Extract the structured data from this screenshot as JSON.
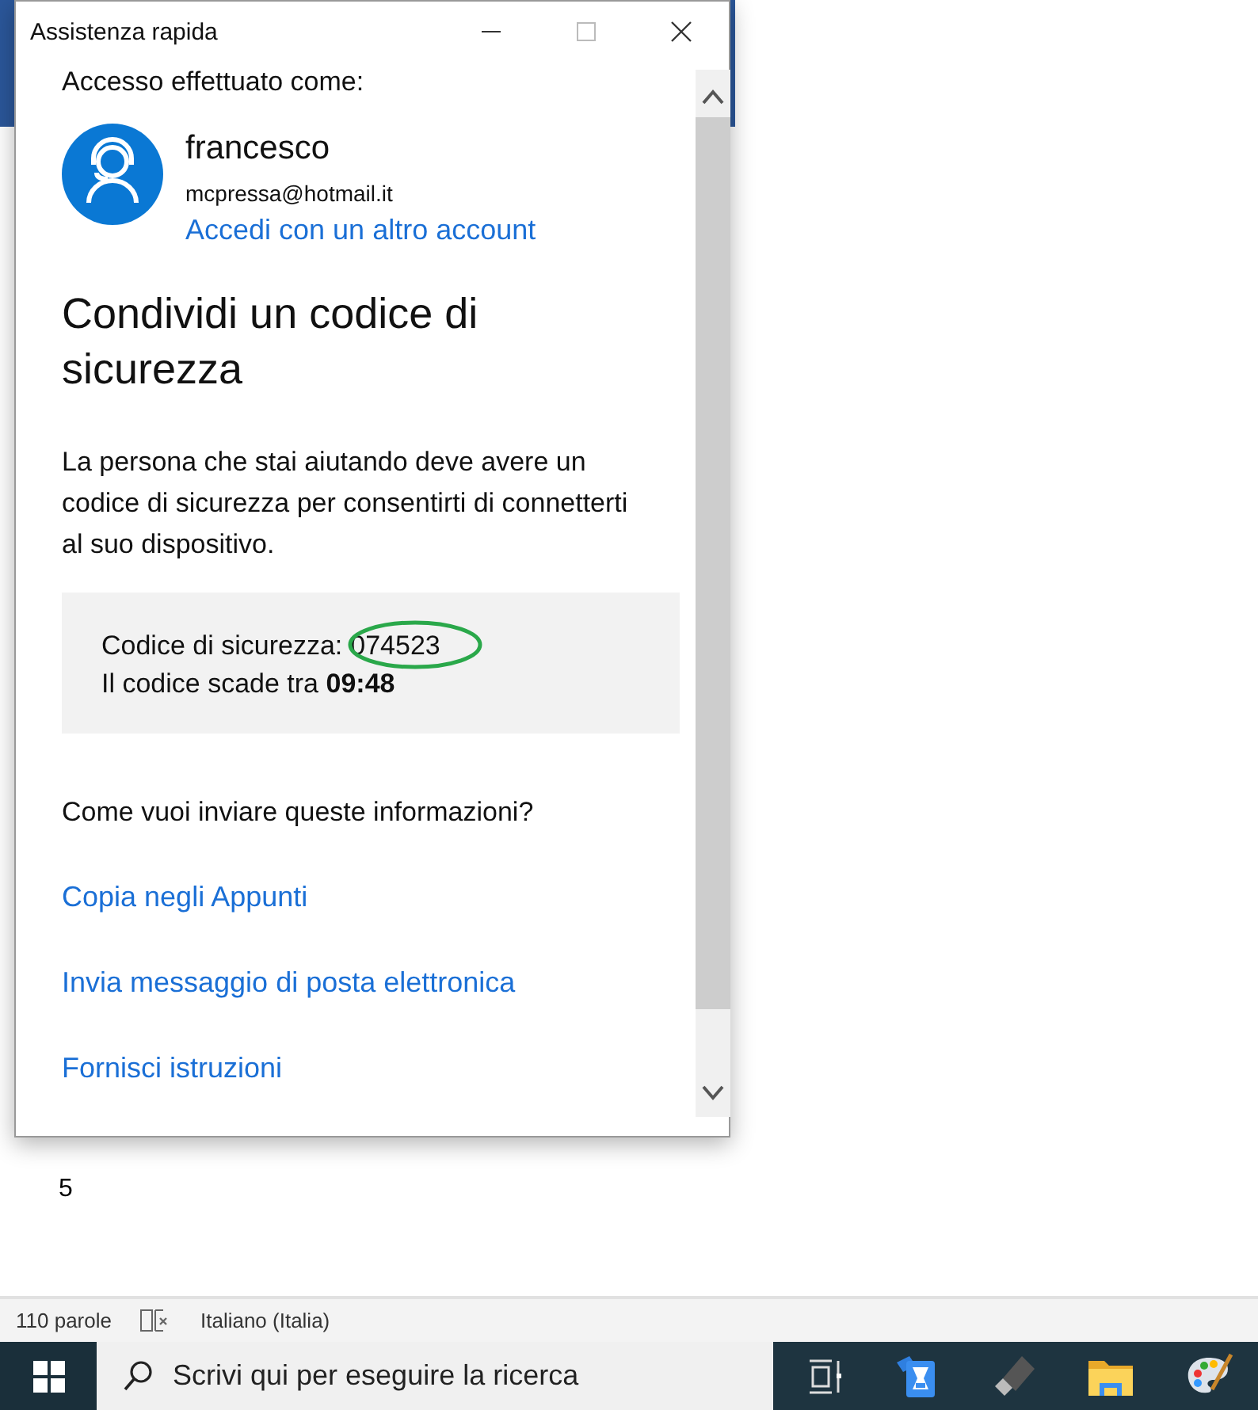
{
  "dialog": {
    "title": "Assistenza rapida",
    "signed_in_label": "Accesso effettuato come:",
    "user": {
      "name": "francesco",
      "email": "mcpressa@hotmail.it",
      "switch_account_link": "Accedi con un altro account"
    },
    "heading": "Condividi un codice di sicurezza",
    "description": "La persona che stai aiutando deve avere un codice di sicurezza per consentirti di connetterti al suo dispositivo.",
    "code_box": {
      "code_label": "Codice di sicurezza:",
      "code": "074523",
      "expiry": "Il codice scade tra **09:48**"
    },
    "send_prompt": "Come vuoi inviare queste informazioni?",
    "send_options": [
      "Copia negli Appunti",
      "Invia messaggio di posta elettronica",
      "Fornisci istruzioni"
    ]
  },
  "document": {
    "text": "5"
  },
  "status_bar": {
    "word_count": "110 parole",
    "language": "Italiano (Italia)"
  },
  "taskbar": {
    "search_placeholder": "Scrivi qui per eseguire la ricerca"
  }
}
